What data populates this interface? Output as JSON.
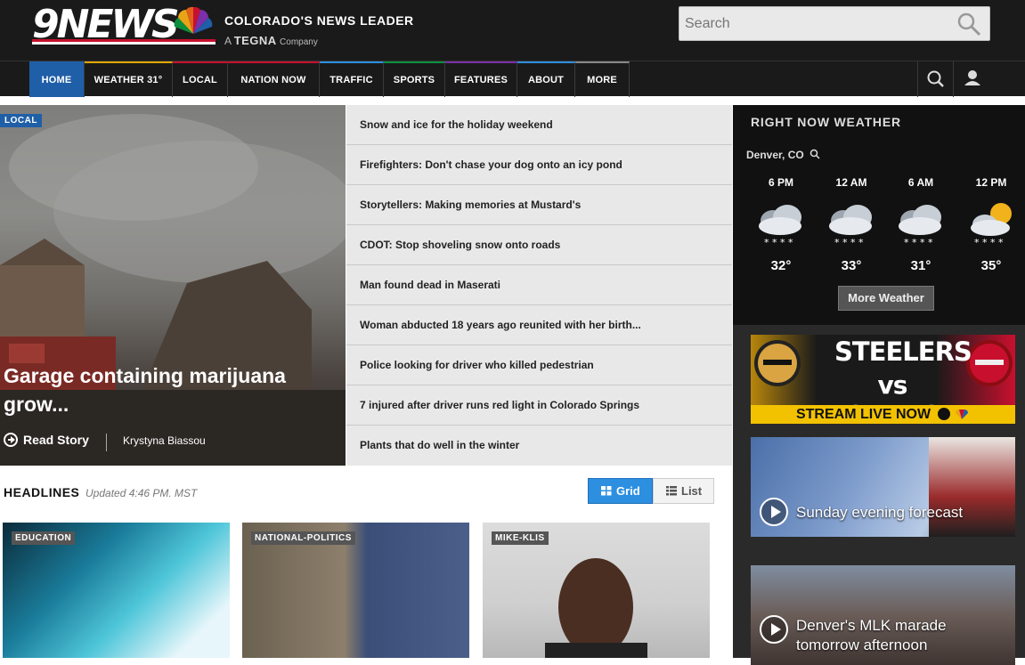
{
  "header": {
    "logo_text": "9NEWS",
    "tagline": "COLORADO'S NEWS LEADER",
    "tegna_prefix": "A",
    "tegna_name": "TEGNA",
    "tegna_suffix": "Company",
    "search_placeholder": "Search"
  },
  "nav": {
    "items": [
      "HOME",
      "WEATHER 31°",
      "LOCAL",
      "NATION NOW",
      "TRAFFIC",
      "SPORTS",
      "FEATURES",
      "ABOUT",
      "MORE"
    ],
    "accent_colors": [
      "#1f5fa7",
      "#e0a800",
      "#c8102e",
      "#c8102e",
      "#2d8fe0",
      "#0a8f3c",
      "#7b2fa8",
      "#2d8fe0",
      "#888888"
    ]
  },
  "hero": {
    "tag": "LOCAL",
    "title": "Garage containing marijuana grow...",
    "read_label": "Read Story",
    "author": "Krystyna Biassou"
  },
  "stories": [
    "Snow and ice for the holiday weekend",
    "Firefighters: Don't chase your dog onto an icy pond",
    "Storytellers: Making memories at Mustard's",
    "CDOT: Stop shoveling snow onto roads",
    "Man found dead in Maserati",
    "Woman abducted 18 years ago reunited with her birth...",
    "Police looking for driver who killed pedestrian",
    "7 injured after driver runs red light in Colorado Springs",
    "Plants that do well in the winter"
  ],
  "weather": {
    "title": "RIGHT NOW WEATHER",
    "location": "Denver, CO",
    "hours": [
      "6 PM",
      "12 AM",
      "6 AM",
      "12 PM"
    ],
    "icons": [
      "snow-cloud-icon",
      "snow-cloud-icon",
      "snow-cloud-icon",
      "snow-sun-icon"
    ],
    "temps": [
      "32°",
      "33°",
      "31°",
      "35°"
    ],
    "more_label": "More Weather"
  },
  "ad": {
    "line1": "STEELERS",
    "line2": "vs CHIEFS",
    "cta": "STREAM LIVE NOW"
  },
  "videos": [
    {
      "title": "Sunday evening forecast"
    },
    {
      "title": "Denver's MLK marade tomorrow afternoon"
    }
  ],
  "headlines": {
    "label": "HEADLINES",
    "updated": "Updated 4:46 PM. MST",
    "grid_label": "Grid",
    "list_label": "List",
    "cards": [
      {
        "tag": "EDUCATION"
      },
      {
        "tag": "NATIONAL-POLITICS"
      },
      {
        "tag": "MIKE-KLIS"
      }
    ]
  }
}
